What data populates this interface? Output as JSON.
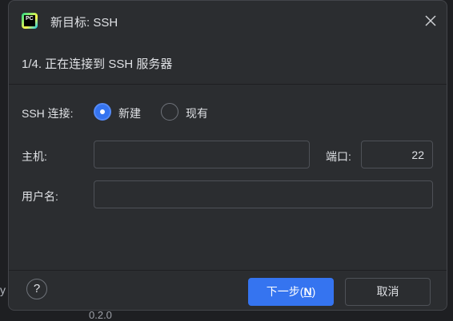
{
  "background": {
    "left_text": "y",
    "bottom_text": "0.2.0"
  },
  "dialog": {
    "title": "新目标: SSH",
    "app_icon_text": "PC",
    "step_text": "1/4. 正在连接到 SSH 服务器",
    "connection": {
      "label": "SSH 连接:",
      "options": [
        {
          "label": "新建",
          "selected": true
        },
        {
          "label": "现有",
          "selected": false
        }
      ]
    },
    "host": {
      "label": "主机:",
      "value": ""
    },
    "port": {
      "label": "端口:",
      "value": "22"
    },
    "username": {
      "label": "用户名:",
      "value": ""
    },
    "help_label": "?",
    "next_button": {
      "label": "下一步(",
      "mnemonic": "N",
      "suffix": ")"
    },
    "cancel_button": {
      "label": "取消"
    }
  },
  "colors": {
    "accent": "#3574f0",
    "dialog_bg": "#2b2d30",
    "page_bg": "#1e1f22"
  }
}
